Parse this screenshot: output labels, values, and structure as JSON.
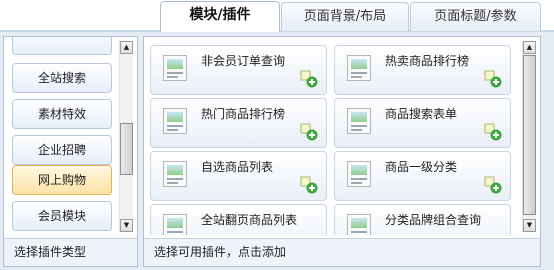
{
  "tabs": [
    {
      "label": "模块/插件",
      "active": true
    },
    {
      "label": "页面背景/布局",
      "active": false
    },
    {
      "label": "页面标题/参数",
      "active": false
    }
  ],
  "left_panel": {
    "items": [
      {
        "label": "",
        "selected": false
      },
      {
        "label": "全站搜索",
        "selected": false
      },
      {
        "label": "素材特效",
        "selected": false
      },
      {
        "label": "企业招聘",
        "selected": false
      },
      {
        "label": "网上购物",
        "selected": true
      },
      {
        "label": "会员模块",
        "selected": false
      }
    ],
    "footer": "选择插件类型"
  },
  "right_panel": {
    "cards": [
      {
        "label": "非会员订单查询"
      },
      {
        "label": "热卖商品排行榜"
      },
      {
        "label": "热门商品排行榜"
      },
      {
        "label": "商品搜索表单"
      },
      {
        "label": "自选商品列表"
      },
      {
        "label": "商品一级分类"
      },
      {
        "label": "全站翻页商品列表"
      },
      {
        "label": "分类品牌组合查询"
      }
    ],
    "footer": "选择可用插件，点击添加"
  },
  "icons": {
    "scroll_up": "arrow-up-icon",
    "scroll_down": "arrow-down-icon",
    "plugin_thumb": "image-thumbnail-icon",
    "add": "add-plus-icon"
  },
  "colors": {
    "selected_item": "#fce3a5",
    "panel_border": "#aebfd5",
    "frame_bg": "#e5ecf5"
  }
}
